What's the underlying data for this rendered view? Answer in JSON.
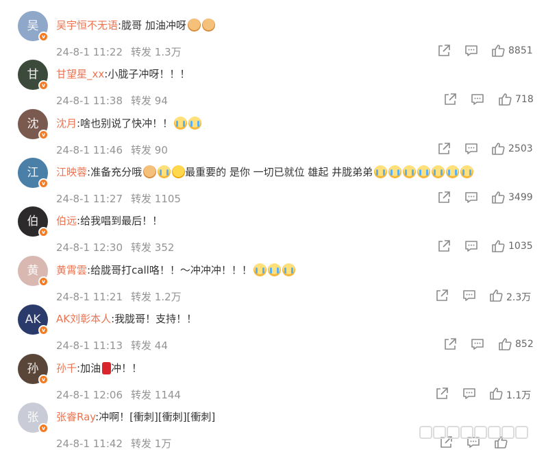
{
  "comments": [
    {
      "user": "吴宇恒不无语",
      "text": ":胧哥 加油冲呀",
      "emojis": [
        "cat",
        "cat"
      ],
      "date": "24-8-1 11:22",
      "repost_label": "转发",
      "reposts": "1.3万",
      "likes": "8851",
      "avatar_color": "#8fa8c9",
      "avatar_initial": "吴"
    },
    {
      "user": "甘望星_xx",
      "text": ":小胧子冲呀！！！",
      "emojis": [],
      "date": "24-8-1 11:38",
      "repost_label": "转发",
      "reposts": "94",
      "likes": "718",
      "avatar_color": "#3b4a3a",
      "avatar_initial": "甘"
    },
    {
      "user": "沈月",
      "text": ":啥也别说了快冲！！",
      "emojis": [
        "cry",
        "cry"
      ],
      "date": "24-8-1 11:46",
      "repost_label": "转发",
      "reposts": "90",
      "likes": "2503",
      "avatar_color": "#7a5a4e",
      "avatar_initial": "沈"
    },
    {
      "user": "江映蓉",
      "text": ":准备充分哦",
      "emojis": [
        "cat",
        "cry",
        "laugh"
      ],
      "text2": "最重要的 是你 一切已就位  雄起 井胧弟弟",
      "emojis2": [
        "cry",
        "cry",
        "cry",
        "cry",
        "cry",
        "cry",
        "cry"
      ],
      "date": "24-8-1 11:27",
      "repost_label": "转发",
      "reposts": "1105",
      "likes": "3499",
      "avatar_color": "#4a7fa8",
      "avatar_initial": "江"
    },
    {
      "user": "伯远",
      "text": ":给我唱到最后！！",
      "emojis": [],
      "date": "24-8-1 12:30",
      "repost_label": "转发",
      "reposts": "352",
      "likes": "1035",
      "avatar_color": "#2c2a2a",
      "avatar_initial": "伯"
    },
    {
      "user": "黄霄雲",
      "text": ":给胧哥打call咯！！～冲冲冲！！！",
      "emojis": [
        "cry",
        "cry",
        "cry"
      ],
      "date": "24-8-1 11:21",
      "repost_label": "转发",
      "reposts": "1.2万",
      "likes": "2.3万",
      "avatar_color": "#d8b8b0",
      "avatar_initial": "黄"
    },
    {
      "user": "AK刘彰本人",
      "text": ":我胧哥！支持！！",
      "emojis": [],
      "date": "24-8-1 11:13",
      "repost_label": "转发",
      "reposts": "44",
      "likes": "852",
      "avatar_color": "#2a3a6a",
      "avatar_initial": "AK"
    },
    {
      "user": "孙千",
      "text": ":加油",
      "emojis": [
        "fuel"
      ],
      "text2": "冲！！",
      "emojis2": [],
      "date": "24-8-1 12:06",
      "repost_label": "转发",
      "reposts": "1144",
      "likes": "1.1万",
      "avatar_color": "#5a4638",
      "avatar_initial": "孙"
    },
    {
      "user": "张睿Ray",
      "text": ":冲啊！[衝刺][衝刺][衝刺]",
      "emojis": [],
      "date": "24-8-1 11:42",
      "repost_label": "转发",
      "reposts": "1万",
      "likes": "",
      "avatar_color": "#c9ccd6",
      "avatar_initial": "张"
    }
  ],
  "badge_symbol": "v",
  "colors": {
    "username": "#eb7350",
    "meta": "#939393",
    "badge": "#f57b22"
  },
  "icons": [
    "share-icon",
    "comment-icon",
    "like-icon"
  ]
}
